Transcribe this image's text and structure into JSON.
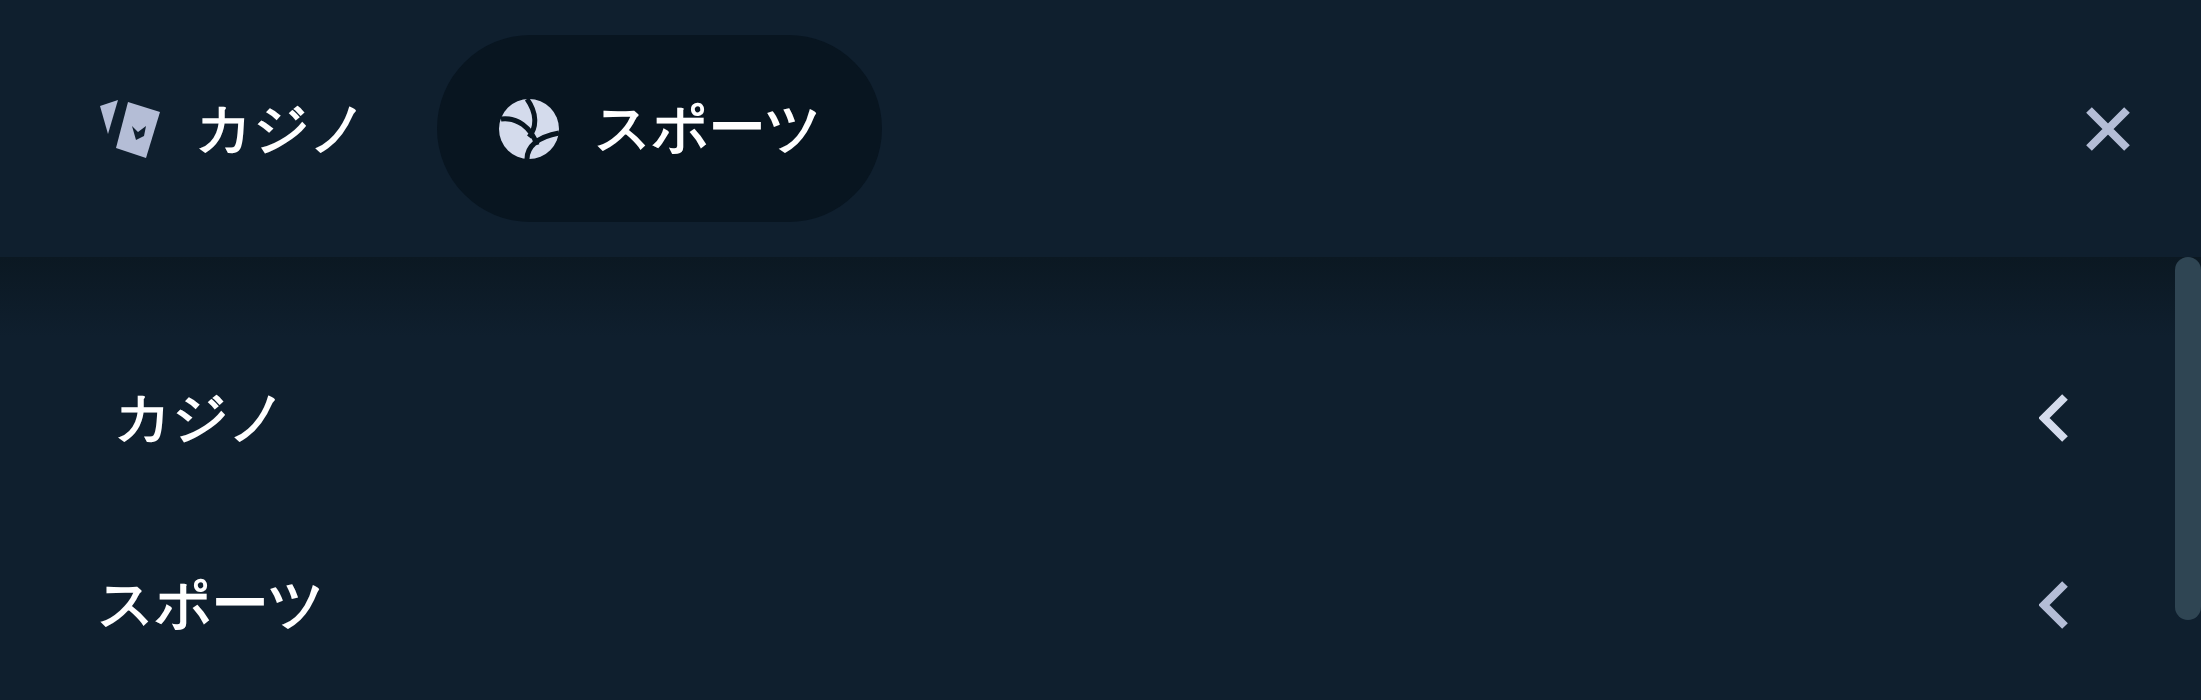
{
  "tabs": [
    {
      "label": "カジノ",
      "selected": false
    },
    {
      "label": "スポーツ",
      "selected": true
    }
  ],
  "menu": [
    {
      "label": "カジノ"
    },
    {
      "label": "スポーツ"
    }
  ]
}
